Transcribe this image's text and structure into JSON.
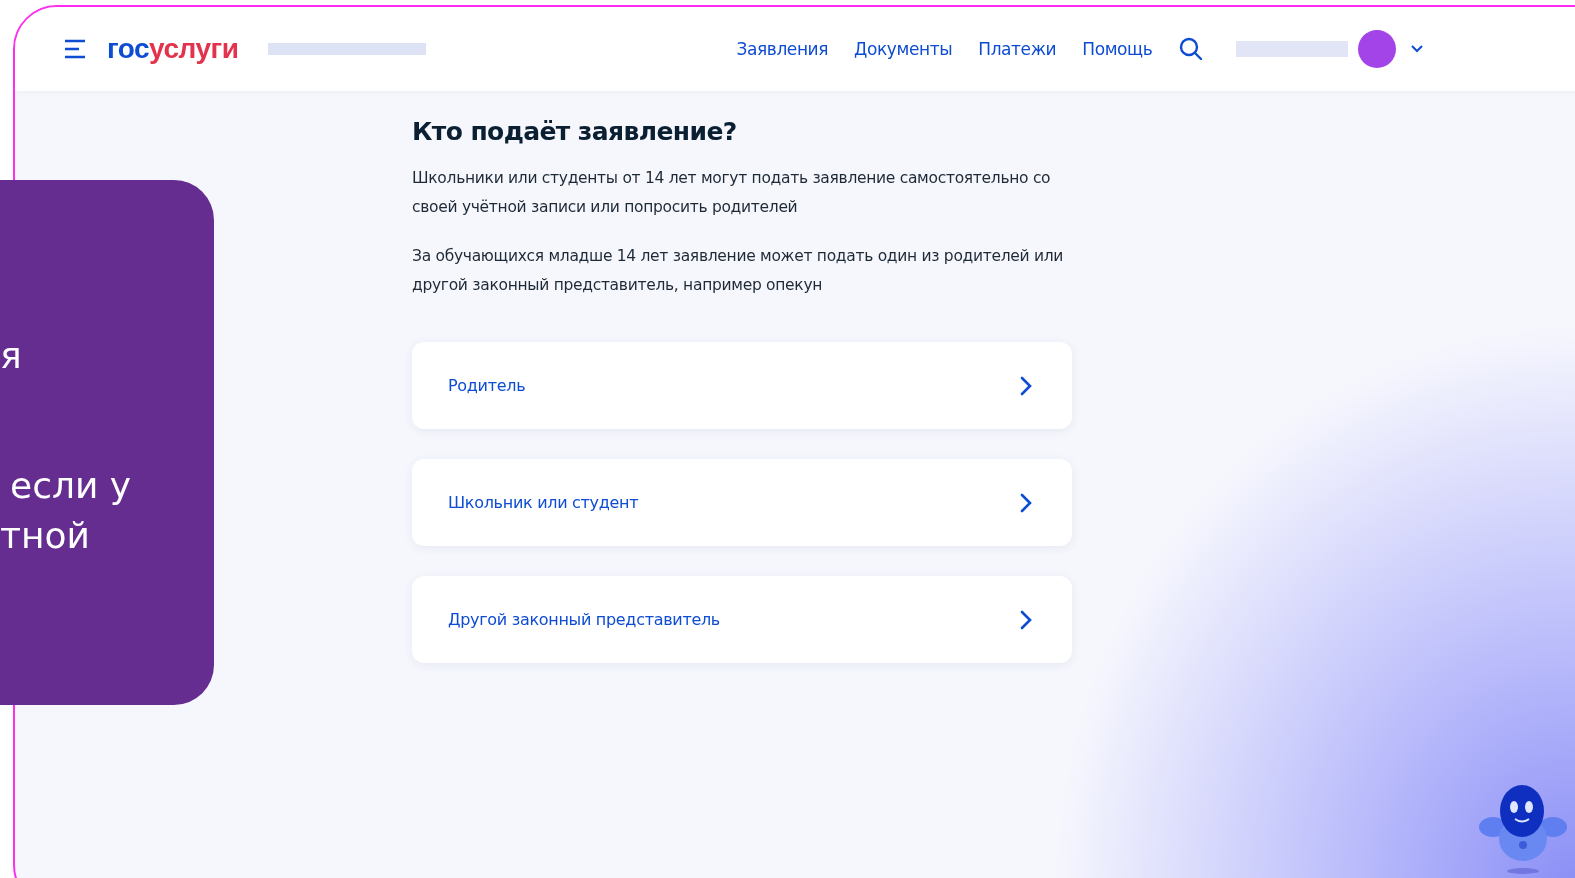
{
  "header": {
    "logo": [
      "гос",
      "услуги"
    ],
    "nav": [
      {
        "label": "Заявления"
      },
      {
        "label": "Документы"
      },
      {
        "label": "Платежи"
      },
      {
        "label": "Помощь"
      }
    ]
  },
  "main": {
    "title": "Кто подаёт заявление?",
    "paragraphs": [
      "Школьники или студенты от 14 лет могут подать заявление самостоятельно со своей учётной записи или попросить родителей",
      "За обучающихся младше 14 лет заявление может подать один из родителей или другой законный представитель, например опекун"
    ],
    "options": [
      {
        "label": "Родитель"
      },
      {
        "label": "Школьник или студент"
      },
      {
        "label": "Другой законный представитель"
      }
    ]
  },
  "overlay_card": {
    "lines": [
      "я",
      "если у",
      "тной"
    ]
  }
}
